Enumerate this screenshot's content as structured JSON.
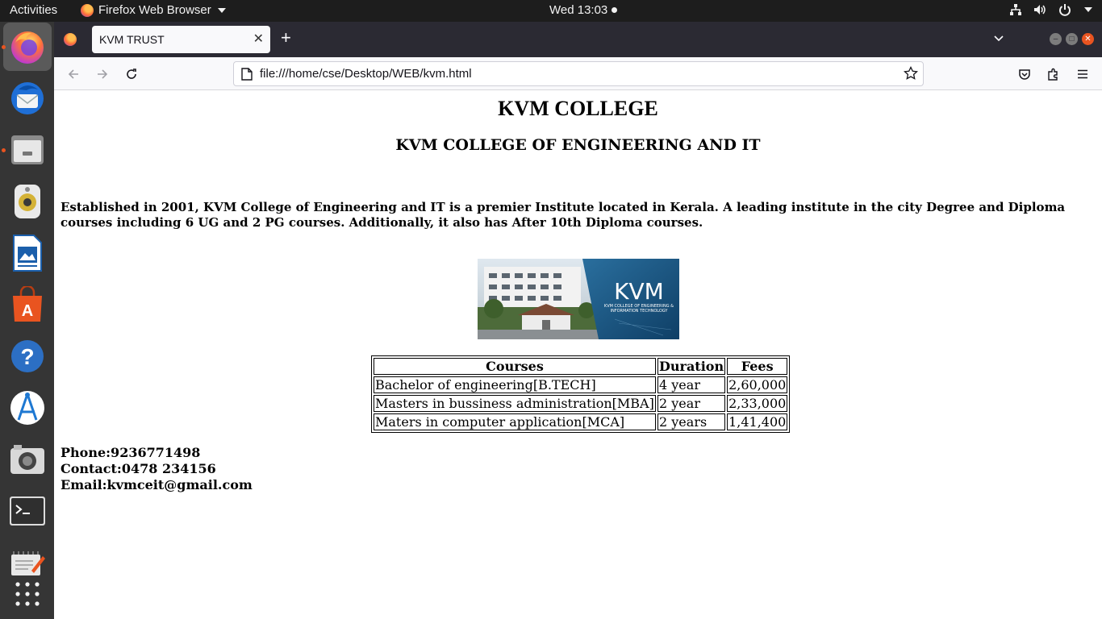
{
  "topbar": {
    "activities": "Activities",
    "app_name": "Firefox Web Browser",
    "clock": "Wed 13:03"
  },
  "dock": {
    "items": [
      {
        "name": "firefox",
        "icon": "firefox-icon"
      },
      {
        "name": "thunderbird",
        "icon": "thunderbird-icon"
      },
      {
        "name": "files",
        "icon": "files-icon"
      },
      {
        "name": "rhythmbox",
        "icon": "rhythmbox-icon"
      },
      {
        "name": "libreoffice-writer",
        "icon": "writer-icon"
      },
      {
        "name": "software",
        "icon": "software-store-icon"
      },
      {
        "name": "help",
        "icon": "help-icon"
      },
      {
        "name": "app-store",
        "icon": "app-store-icon"
      },
      {
        "name": "camera",
        "icon": "camera-icon"
      },
      {
        "name": "terminal",
        "icon": "terminal-icon"
      },
      {
        "name": "text-editor",
        "icon": "text-editor-icon"
      },
      {
        "name": "show-applications",
        "icon": "app-grid-icon"
      }
    ]
  },
  "browser": {
    "tab_title": "KVM TRUST",
    "url": "file:///home/cse/Desktop/WEB/kvm.html"
  },
  "page": {
    "title": "KVM COLLEGE",
    "subtitle": "KVM COLLEGE OF ENGINEERING AND IT",
    "description": "Established in 2001, KVM College of Engineering and IT is a premier Institute located in Kerala. A leading institute in the city Degree and Diploma courses including 6 UG and 2 PG courses. Additionally, it also has After 10th Diploma courses.",
    "image": {
      "logo_text": "KVM",
      "logo_subtext_line1": "KVM COLLEGE OF ENGINEERING &",
      "logo_subtext_line2": "INFORMATION TECHNOLOGY"
    },
    "table": {
      "headers": [
        "Courses",
        "Duration",
        "Fees"
      ],
      "rows": [
        [
          "Bachelor of engineering[B.TECH]",
          "4 year",
          "2,60,000"
        ],
        [
          "Masters in bussiness administration[MBA]",
          "2 year",
          "2,33,000"
        ],
        [
          "Maters in computer application[MCA]",
          "2 years",
          "1,41,400"
        ]
      ]
    },
    "contact": {
      "phone": "Phone:9236771498",
      "contact": "Contact:0478 234156",
      "email": "Email:kvmceit@gmail.com"
    }
  },
  "colors": {
    "accent": "#e95420",
    "topbar": "#1d1d1d",
    "dock": "#353535",
    "tabbar": "#2b2a33",
    "navbar": "#f9f9fb"
  }
}
